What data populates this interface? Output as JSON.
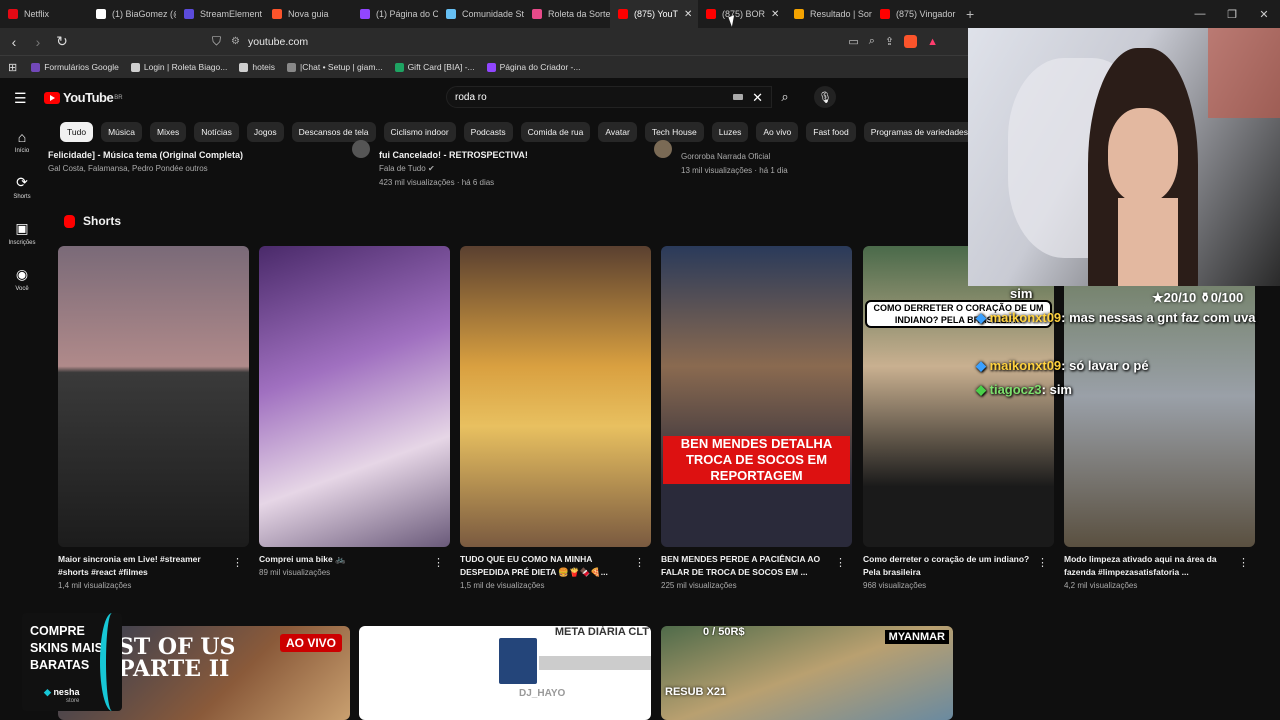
{
  "browser": {
    "tabs": [
      {
        "label": "Netflix",
        "color": "#e50914"
      },
      {
        "label": "(1) BiaGomez (@",
        "color": "#ffffff"
      },
      {
        "label": "StreamElement",
        "color": "#5b4bdb"
      },
      {
        "label": "Nova guia",
        "color": "#fb542b"
      },
      {
        "label": "(1) Página do C",
        "color": "#9146ff"
      },
      {
        "label": "Comunidade St",
        "color": "#66c0f4"
      },
      {
        "label": "Roleta da Sorte",
        "color": "#e84a8a"
      },
      {
        "label": "(875) YouT",
        "color": "#ff0000",
        "active": true
      },
      {
        "label": "(875) BOR",
        "color": "#ff0000"
      },
      {
        "label": "Resultado | Sor",
        "color": "#f4a300"
      },
      {
        "label": "(875) Vingador",
        "color": "#ff0000"
      }
    ],
    "url": "youtube.com",
    "bookmarks": [
      {
        "label": "Formulários Google",
        "color": "#7248b9"
      },
      {
        "label": "Login | Roleta Biago...",
        "color": "#cfcfcf"
      },
      {
        "label": "hoteis",
        "color": "#cfcfcf"
      },
      {
        "label": "|Chat • Setup | giam...",
        "color": "#888888"
      },
      {
        "label": "Gift Card [BIA] -...",
        "color": "#1ea362"
      },
      {
        "label": "Página do Criador -...",
        "color": "#9146ff"
      }
    ]
  },
  "youtube": {
    "logo": "YouTube",
    "region": "BR",
    "search_query": "roda ro",
    "chips": [
      "Tudo",
      "Música",
      "Mixes",
      "Notícias",
      "Jogos",
      "Descansos de tela",
      "Ciclismo indoor",
      "Podcasts",
      "Comida de rua",
      "Avatar",
      "Tech House",
      "Luzes",
      "Ao vivo",
      "Fast food",
      "Programas de variedades"
    ],
    "guide": [
      {
        "label": "Início",
        "icon": "home-icon"
      },
      {
        "label": "Shorts",
        "icon": "shorts-icon"
      },
      {
        "label": "Inscrições",
        "icon": "subscriptions-icon"
      },
      {
        "label": "Você",
        "icon": "you-icon"
      }
    ],
    "top_videos": [
      {
        "title": "Felicidade] - Música tema (Original Completa)",
        "meta": "Gal Costa, Falamansa, Pedro Pondée outros"
      },
      {
        "title": "fui Cancelado! - RETROSPECTIVA!",
        "channel": "Fala de Tudo",
        "meta": "423 mil visualizações · há 6 dias"
      },
      {
        "channel": "Gororoba Narrada Oficial",
        "meta": "13 mil visualizações · há 1 dia"
      }
    ],
    "shorts_heading": "Shorts",
    "shorts": [
      {
        "title": "Maior sincronia em Live! #streamer #shorts #react #filmes",
        "views": "1,4 mil visualizações"
      },
      {
        "title": "Comprei uma bike 🚲",
        "views": "89 mil visualizações"
      },
      {
        "title": "TUDO QUE EU COMO NA MINHA DESPEDIDA PRÉ DIETA 🍔🍟🍫🍕...",
        "views": "1,5 mil de visualizações"
      },
      {
        "title": "BEN MENDES PERDE A PACIÊNCIA AO FALAR DE TROCA DE SOCOS EM ...",
        "views": "225 mil visualizações",
        "caption": "BEN MENDES DETALHA TROCA DE SOCOS EM REPORTAGEM"
      },
      {
        "title": "Como derreter o coração de um indiano? Pela brasileira",
        "views": "968 visualizações",
        "caption": "COMO DERRETER O CORAÇÃO DE UM INDIANO? PELA BRASILEIRA"
      },
      {
        "title": "Modo limpeza ativado aqui na área da fazenda #limpezasatisfatoria ...",
        "views": "4,2 mil visualizações"
      }
    ],
    "bottom_cards": [
      {
        "overlay": "ST OF US PARTE II",
        "badge": "AO VIVO"
      },
      {
        "overlay": "META DIÁRIA CLT",
        "sub": "DJ_HAYO"
      },
      {
        "overlay": "0 / 50R$",
        "badge": "MYANMAR",
        "sub": "RESUB X21"
      }
    ]
  },
  "stream_overlay": {
    "goal": "★20/10 ⚱0/100",
    "chat": [
      {
        "user": "",
        "msg": "sim"
      },
      {
        "user": "maikonxt09",
        "msg": "mas nessas a gnt faz com uva"
      },
      {
        "user": "maikonxt09",
        "msg": "só lavar o pé"
      },
      {
        "user": "tiagocz3",
        "msg": "sim"
      }
    ],
    "promo": {
      "line1": "COMPRE",
      "line2": "SKINS MAIS",
      "line3": "BARATAS",
      "brand": "nesha",
      "brand_sub": "store"
    }
  }
}
